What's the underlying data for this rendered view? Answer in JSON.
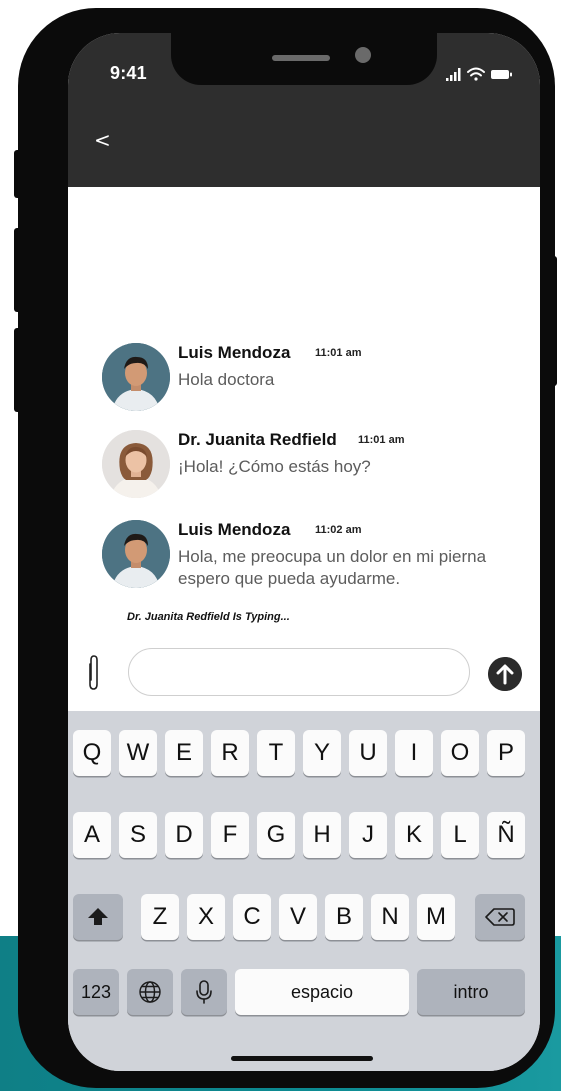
{
  "status_bar": {
    "time": "9:41"
  },
  "header": {
    "back_label": "<"
  },
  "messages": [
    {
      "name": "Luis Mendoza",
      "time": "11:01 am",
      "text": "Hola doctora"
    },
    {
      "name": "Dr. Juanita Redfield",
      "time": "11:01 am",
      "text": "¡Hola! ¿Cómo estás hoy?"
    },
    {
      "name": "Luis Mendoza",
      "time": "11:02 am",
      "text": "Hola, me preocupa un dolor en mi pierna espero que pueda ayudarme."
    }
  ],
  "typing_indicator": "Dr. Juanita Redfield Is Typing...",
  "composer": {
    "value": "",
    "placeholder": ""
  },
  "keyboard": {
    "row1": [
      "Q",
      "W",
      "E",
      "R",
      "T",
      "Y",
      "U",
      "I",
      "O",
      "P"
    ],
    "row2": [
      "A",
      "S",
      "D",
      "F",
      "G",
      "H",
      "J",
      "K",
      "L",
      "Ñ"
    ],
    "row3": [
      "Z",
      "X",
      "C",
      "V",
      "B",
      "N",
      "M"
    ],
    "numbers_label": "123",
    "space_label": "espacio",
    "return_label": "intro"
  },
  "colors": {
    "header_bg": "#2e2e2e",
    "background_accent": "#0f7f86",
    "keyboard_bg": "#d0d3d9"
  }
}
